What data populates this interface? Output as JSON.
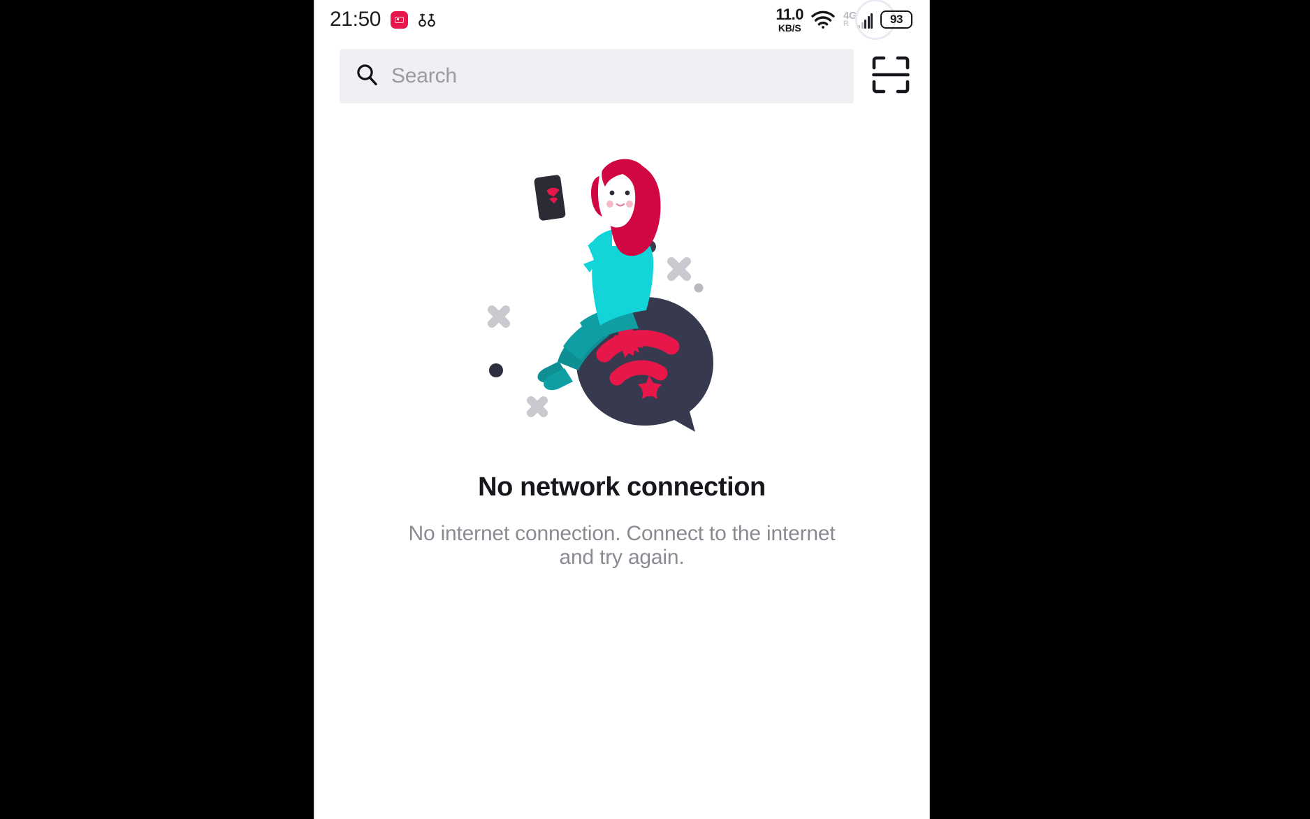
{
  "status_bar": {
    "clock": "21:50",
    "app_badge_name": "video-app-badge",
    "glyph_name": "scissors-glyph",
    "network_rate": "11.0",
    "network_unit": "KB/S",
    "wifi_icon": "wifi-icon",
    "signal_label": "4G",
    "signal_sub": "R",
    "battery_percent": "93"
  },
  "search": {
    "placeholder": "Search",
    "value": "",
    "icon": "search-icon",
    "scan_icon": "scan-code-icon"
  },
  "empty_state": {
    "illustration_name": "no-network-illustration",
    "title": "No network connection",
    "subtitle": "No internet connection. Connect to the internet and try again."
  },
  "colors": {
    "accent_red": "#e8174a",
    "bubble_dark": "#373a4e",
    "shirt_cyan": "#13d4d9",
    "pants_teal": "#0d9396",
    "hair_crimson": "#d00743",
    "search_bg": "#f0f0f4",
    "text_primary": "#16161c",
    "text_muted": "#8a8a93"
  }
}
